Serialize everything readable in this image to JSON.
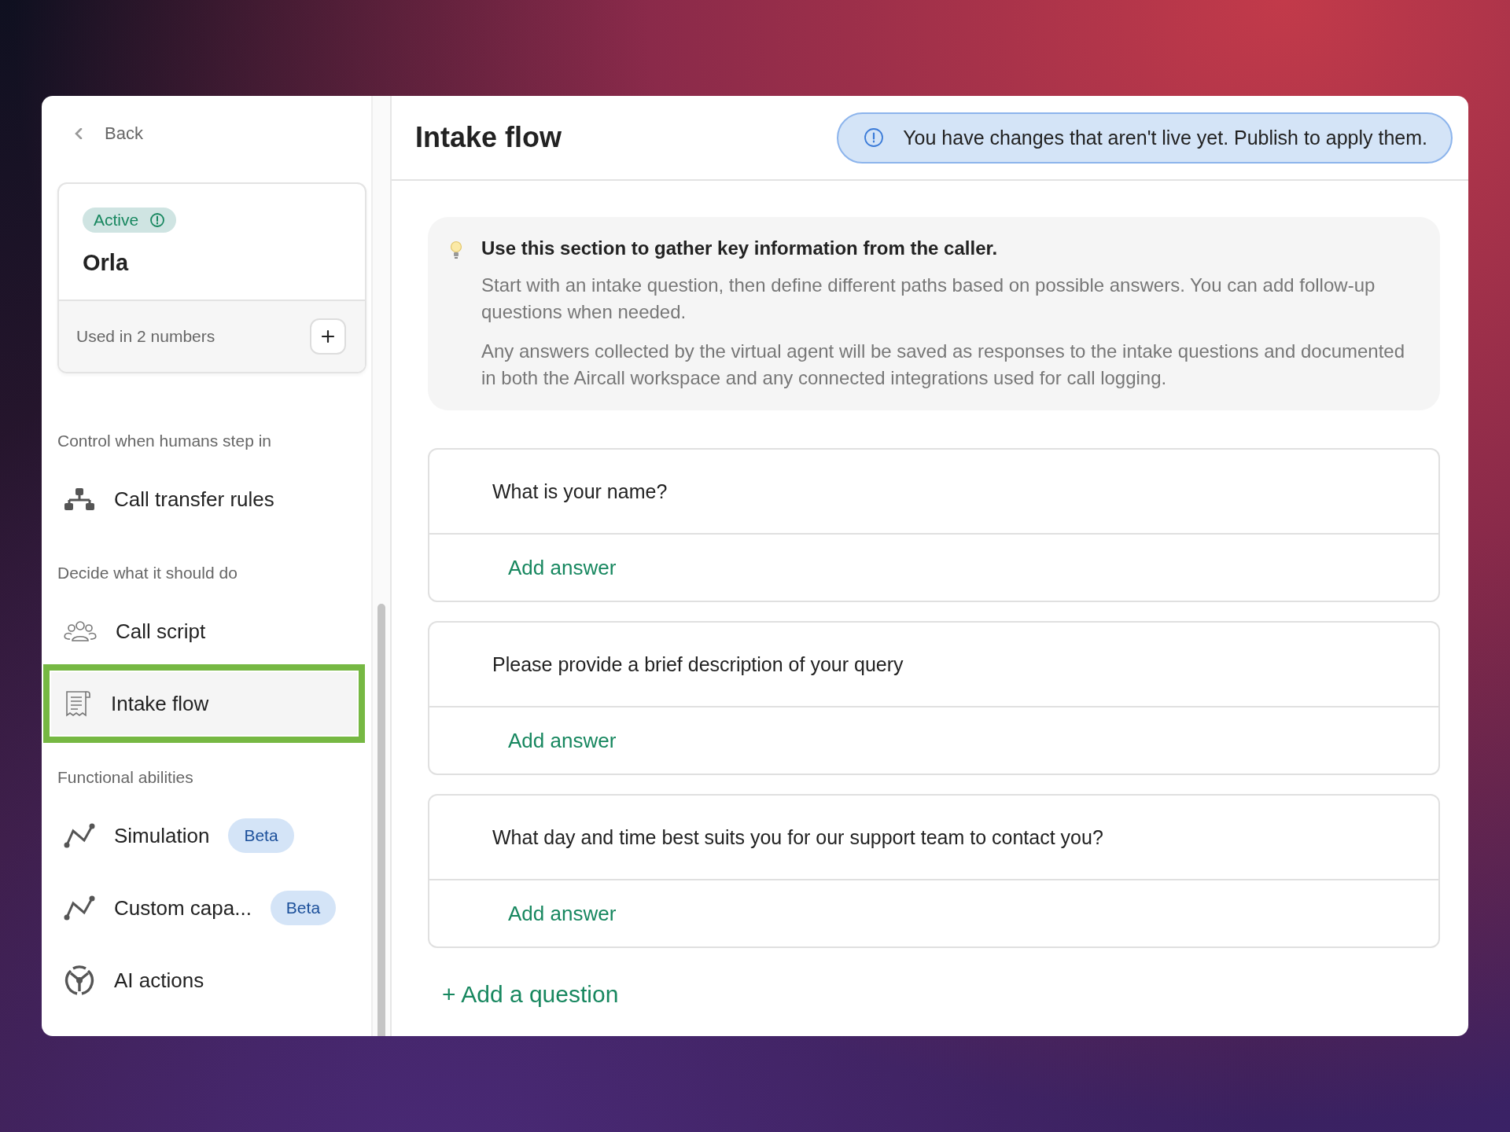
{
  "back": {
    "label": "Back"
  },
  "agent": {
    "status": "Active",
    "name": "Orla",
    "usage": "Used in 2 numbers"
  },
  "sections": [
    {
      "heading": "Control when humans step in",
      "items": [
        {
          "label": "Call transfer rules",
          "selected": false
        }
      ]
    },
    {
      "heading": "Decide what it should do",
      "items": [
        {
          "label": "Call script",
          "selected": false
        },
        {
          "label": "Intake flow",
          "selected": true
        }
      ]
    },
    {
      "heading": "Functional abilities",
      "items": [
        {
          "label": "Simulation",
          "selected": false,
          "badge": "Beta"
        },
        {
          "label": "Custom capa...",
          "selected": false,
          "badge": "Beta"
        },
        {
          "label": "AI actions",
          "selected": false
        }
      ]
    }
  ],
  "page_title": "Intake flow",
  "notice": "You have changes that aren't live yet. Publish to apply them.",
  "tip": {
    "title": "Use this section to gather key information from the caller.",
    "paragraphs": [
      "Start with an intake question, then define different paths based on possible answers. You can add follow-up questions when needed.",
      "Any answers collected by the virtual agent will be saved as responses to the intake questions and documented in both the Aircall workspace and any connected integrations used for call logging."
    ]
  },
  "questions": [
    {
      "text": "What is your name?",
      "add_answer": "Add answer"
    },
    {
      "text": "Please provide a brief description of your query",
      "add_answer": "Add answer"
    },
    {
      "text": "What day and time best suits you for our support team to contact you?",
      "add_answer": "Add answer"
    }
  ],
  "add_question": "+ Add a question"
}
